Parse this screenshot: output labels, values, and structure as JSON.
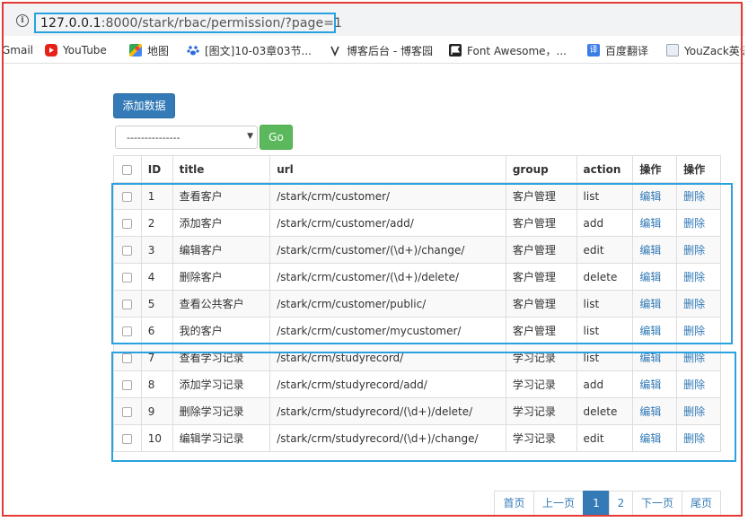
{
  "browser": {
    "url_host": "127.0.0.1",
    "url_path": ":8000/stark/rbac/permission/?page=1"
  },
  "bookmarks": [
    {
      "label": "Gmail",
      "icon": "gmail-icon",
      "color": "#ffffff"
    },
    {
      "label": "YouTube",
      "icon": "youtube-icon",
      "color": "#e62117"
    },
    {
      "label": "地图",
      "icon": "maps-icon",
      "color": "#34a853"
    },
    {
      "label": "[图文]10-03章03节...",
      "icon": "paw-icon",
      "color": "#2b6bd9"
    },
    {
      "label": "博客后台 - 博客园",
      "icon": "cnblogs-icon",
      "color": "#333333"
    },
    {
      "label": "Font Awesome，...",
      "icon": "flag-icon",
      "color": "#222222"
    },
    {
      "label": "百度翻译",
      "icon": "baidu-translate-icon",
      "color": "#3b7de8"
    },
    {
      "label": "YouZack英语",
      "icon": "page-icon",
      "color": "#9aa7b5"
    }
  ],
  "toolbar": {
    "add_label": "添加数据",
    "select_value": "---------------",
    "go_label": "Go"
  },
  "table": {
    "headers": [
      "ID",
      "title",
      "url",
      "group",
      "action",
      "操作",
      "操作"
    ],
    "rows": [
      {
        "id": "1",
        "title": "查看客户",
        "url": "/stark/crm/customer/",
        "group": "客户管理",
        "action": "list",
        "edit": "编辑",
        "delete": "删除"
      },
      {
        "id": "2",
        "title": "添加客户",
        "url": "/stark/crm/customer/add/",
        "group": "客户管理",
        "action": "add",
        "edit": "编辑",
        "delete": "删除"
      },
      {
        "id": "3",
        "title": "编辑客户",
        "url": "/stark/crm/customer/(\\d+)/change/",
        "group": "客户管理",
        "action": "edit",
        "edit": "编辑",
        "delete": "删除"
      },
      {
        "id": "4",
        "title": "删除客户",
        "url": "/stark/crm/customer/(\\d+)/delete/",
        "group": "客户管理",
        "action": "delete",
        "edit": "编辑",
        "delete": "删除"
      },
      {
        "id": "5",
        "title": "查看公共客户",
        "url": "/stark/crm/customer/public/",
        "group": "客户管理",
        "action": "list",
        "edit": "编辑",
        "delete": "删除"
      },
      {
        "id": "6",
        "title": "我的客户",
        "url": "/stark/crm/customer/mycustomer/",
        "group": "客户管理",
        "action": "list",
        "edit": "编辑",
        "delete": "删除"
      },
      {
        "id": "7",
        "title": "查看学习记录",
        "url": "/stark/crm/studyrecord/",
        "group": "学习记录",
        "action": "list",
        "edit": "编辑",
        "delete": "删除"
      },
      {
        "id": "8",
        "title": "添加学习记录",
        "url": "/stark/crm/studyrecord/add/",
        "group": "学习记录",
        "action": "add",
        "edit": "编辑",
        "delete": "删除"
      },
      {
        "id": "9",
        "title": "删除学习记录",
        "url": "/stark/crm/studyrecord/(\\d+)/delete/",
        "group": "学习记录",
        "action": "delete",
        "edit": "编辑",
        "delete": "删除"
      },
      {
        "id": "10",
        "title": "编辑学习记录",
        "url": "/stark/crm/studyrecord/(\\d+)/change/",
        "group": "学习记录",
        "action": "edit",
        "edit": "编辑",
        "delete": "删除"
      }
    ]
  },
  "pagination": {
    "items": [
      "首页",
      "上一页",
      "1",
      "2",
      "下一页",
      "尾页"
    ],
    "active": "1"
  },
  "colors": {
    "primary": "#337ab7",
    "success": "#5cb85c",
    "highlight": "#29a3e0",
    "frame": "#e53935"
  }
}
